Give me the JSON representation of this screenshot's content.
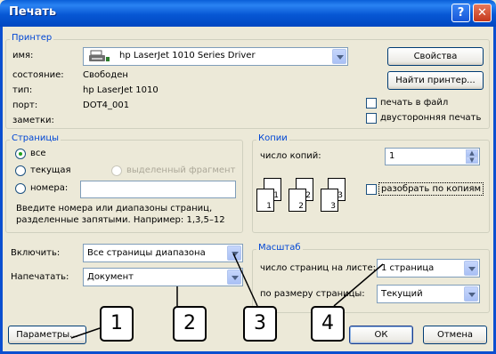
{
  "window": {
    "title": "Печать",
    "help_glyph": "?",
    "close_glyph": "✕"
  },
  "printer": {
    "group_label": "Принтер",
    "name_label": "имя:",
    "name_value": "hp LaserJet 1010 Series Driver",
    "status_label": "состояние:",
    "status_value": "Свободен",
    "type_label": "тип:",
    "type_value": "hp LaserJet 1010",
    "port_label": "порт:",
    "port_value": "DOT4_001",
    "notes_label": "заметки:",
    "properties_button": "Свойства",
    "find_button": "Найти принтер...",
    "print_to_file": "печать в файл",
    "duplex": "двусторонняя печать"
  },
  "pages": {
    "group_label": "Страницы",
    "all": "все",
    "current": "текущая",
    "selection": "выделенный фрагмент",
    "numbers": "номера:",
    "hint": "Введите номера или диапазоны страниц, разделенные запятыми. Например: 1,3,5–12"
  },
  "copies": {
    "group_label": "Копии",
    "count_label": "число копий:",
    "count_value": "1",
    "collate": "разобрать по копиям",
    "icon_numbers": [
      "1",
      "1",
      "2",
      "2",
      "3",
      "3"
    ]
  },
  "include": {
    "label": "Включить:",
    "value": "Все страницы диапазона"
  },
  "print_what": {
    "label": "Напечатать:",
    "value": "Документ"
  },
  "scale": {
    "group_label": "Масштаб",
    "pages_per_sheet_label": "число страниц на листе:",
    "pages_per_sheet_value": "1 страница",
    "fit_to_label": "по размеру страницы:",
    "fit_to_value": "Текущий"
  },
  "buttons": {
    "options": "Параметры...",
    "ok": "ОК",
    "cancel": "Отмена"
  },
  "callouts": [
    "1",
    "2",
    "3",
    "4"
  ]
}
